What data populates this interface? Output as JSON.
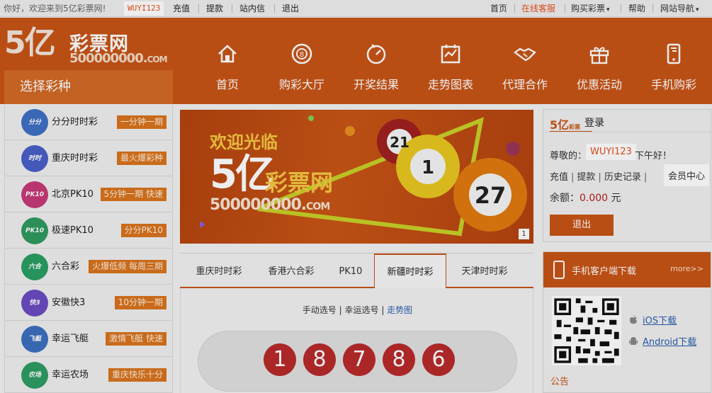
{
  "topbar": {
    "greeting": "你好，欢迎来到5亿彩票网!",
    "username": "WUYI123",
    "links": [
      "充值",
      "提款",
      "站内信",
      "退出"
    ],
    "right_links": [
      "首页",
      "在线客服",
      "购买彩票",
      "帮助",
      "网站导航"
    ],
    "caret": "▾"
  },
  "logo": {
    "mark": "5亿",
    "name": "彩票网",
    "url_main": "500000000.",
    "url_suffix": "COM"
  },
  "nav": {
    "items": [
      {
        "label": "首页",
        "icon": "home-icon"
      },
      {
        "label": "购彩大厅",
        "icon": "lottery-ball-icon"
      },
      {
        "label": "开奖结果",
        "icon": "result-dial-icon"
      },
      {
        "label": "走势图表",
        "icon": "chart-icon"
      },
      {
        "label": "代理合作",
        "icon": "handshake-icon"
      },
      {
        "label": "优惠活动",
        "icon": "gift-icon"
      },
      {
        "label": "手机购彩",
        "icon": "mobile-icon"
      }
    ]
  },
  "sidebar": {
    "title": "选择彩种",
    "items": [
      {
        "name": "分分时时彩",
        "tag": "一分钟一期",
        "badge": "分分",
        "color": "#3f6fc4"
      },
      {
        "name": "重庆时时彩",
        "tag": "最火爆彩种",
        "badge": "时时",
        "color": "#4a5fc9"
      },
      {
        "name": "北京PK10",
        "tag": "5分钟一期 快速",
        "badge": "PK10",
        "color": "#c63a78"
      },
      {
        "name": "极速PK10",
        "tag": "分分PK10",
        "badge": "PK10",
        "color": "#2f9a5e"
      },
      {
        "name": "六合彩",
        "tag": "火爆低频 每周三期",
        "badge": "六合",
        "color": "#2b9f63"
      },
      {
        "name": "安徽快3",
        "tag": "10分钟一期",
        "badge": "快3",
        "color": "#6b4cc2"
      },
      {
        "name": "幸运飞艇",
        "tag": "激情飞艇 快速",
        "badge": "飞艇",
        "color": "#3c6fbf"
      },
      {
        "name": "幸运农场",
        "tag": "重庆快乐十分",
        "badge": "农场",
        "color": "#2f9c63"
      }
    ]
  },
  "banner": {
    "welcome": "欢迎光临",
    "mark": "5亿",
    "name": "彩票网",
    "url_main": "500000000.",
    "url_suffix": "COM",
    "page": "1",
    "balls": [
      "21",
      "1",
      "27"
    ]
  },
  "tabs": [
    "重庆时时彩",
    "香港六合彩",
    "PK10",
    "新疆时时彩",
    "天津时时彩"
  ],
  "pick": {
    "manual": "手动选号",
    "lucky": "幸运选号",
    "sep": " | ",
    "chart": "走势图",
    "balls": [
      "1",
      "8",
      "7",
      "8",
      "6"
    ]
  },
  "account": {
    "brand": "5亿",
    "brand_small": "彩票",
    "login": "登录",
    "dear": "尊敬的：",
    "username": "WUYI123",
    "afternoon": "下午好！",
    "links": [
      "充值",
      "提款",
      "历史记录"
    ],
    "member": "会员中心",
    "balance_label": "余额：",
    "balance": "0.000",
    "unit": "元",
    "logout": "退出"
  },
  "mobile": {
    "title": "手机客户端下载",
    "more": "more>>",
    "ios": "iOS下载",
    "android": "Android下载",
    "notice": "公告"
  },
  "colors": {
    "brand": "#c85417",
    "accent": "#e8501c",
    "ball": "#b82b2b",
    "link": "#2b5fb0"
  }
}
